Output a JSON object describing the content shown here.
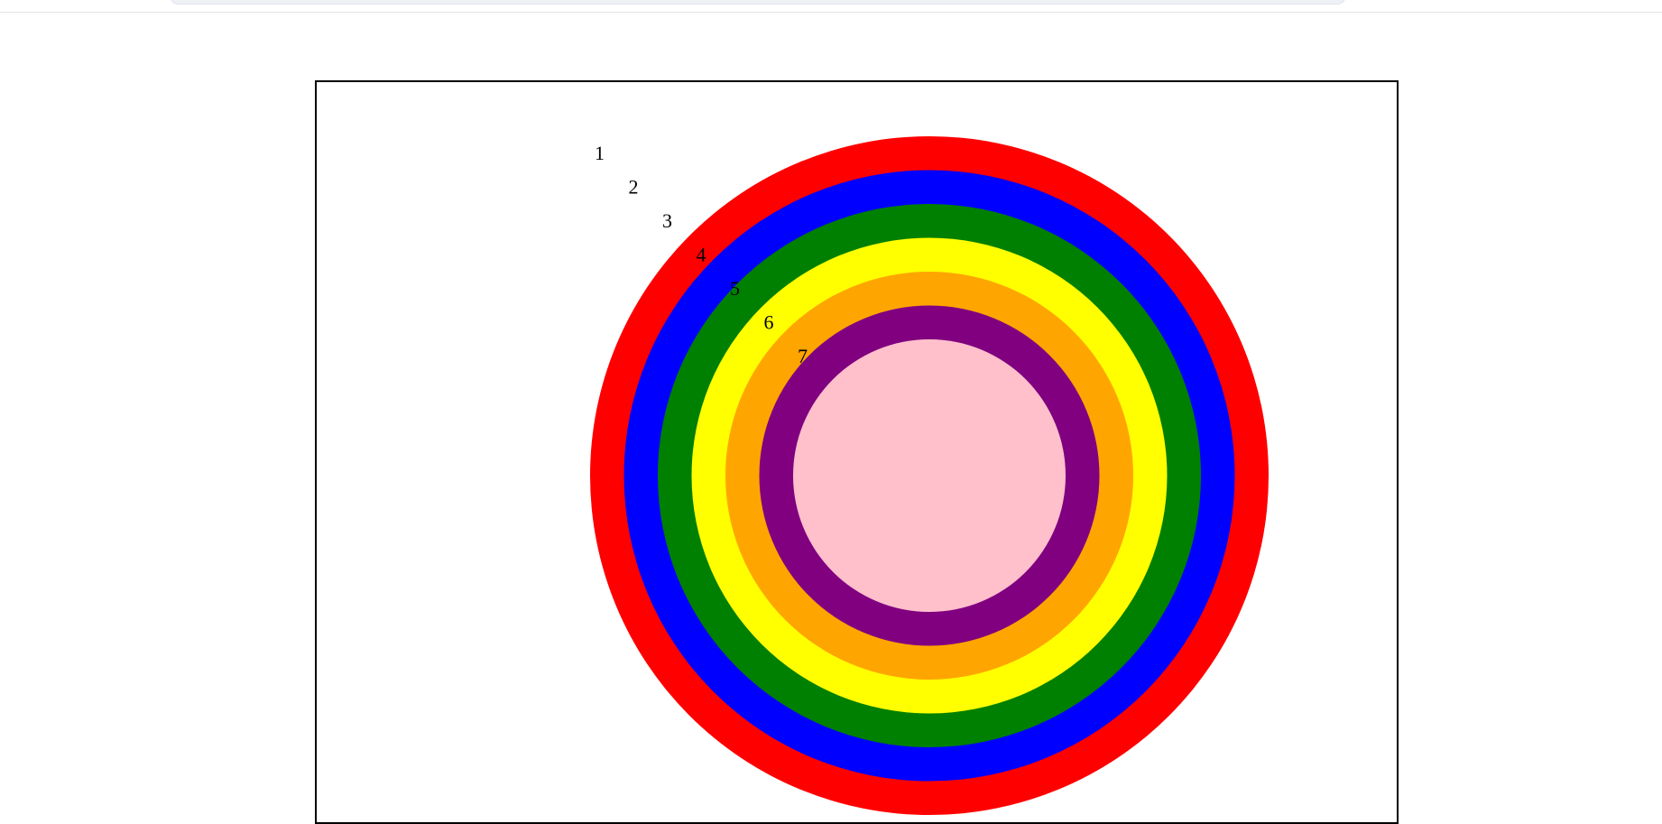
{
  "rings": [
    {
      "label": "1",
      "color": "#ff0000"
    },
    {
      "label": "2",
      "color": "#0000ff"
    },
    {
      "label": "3",
      "color": "#008000"
    },
    {
      "label": "4",
      "color": "#ffff00"
    },
    {
      "label": "5",
      "color": "#ffa500"
    },
    {
      "label": "6",
      "color": "#800080"
    },
    {
      "label": "7",
      "color": "#ffc0cb"
    }
  ],
  "colors": {
    "frame_border": "#000000",
    "background": "#ffffff"
  }
}
